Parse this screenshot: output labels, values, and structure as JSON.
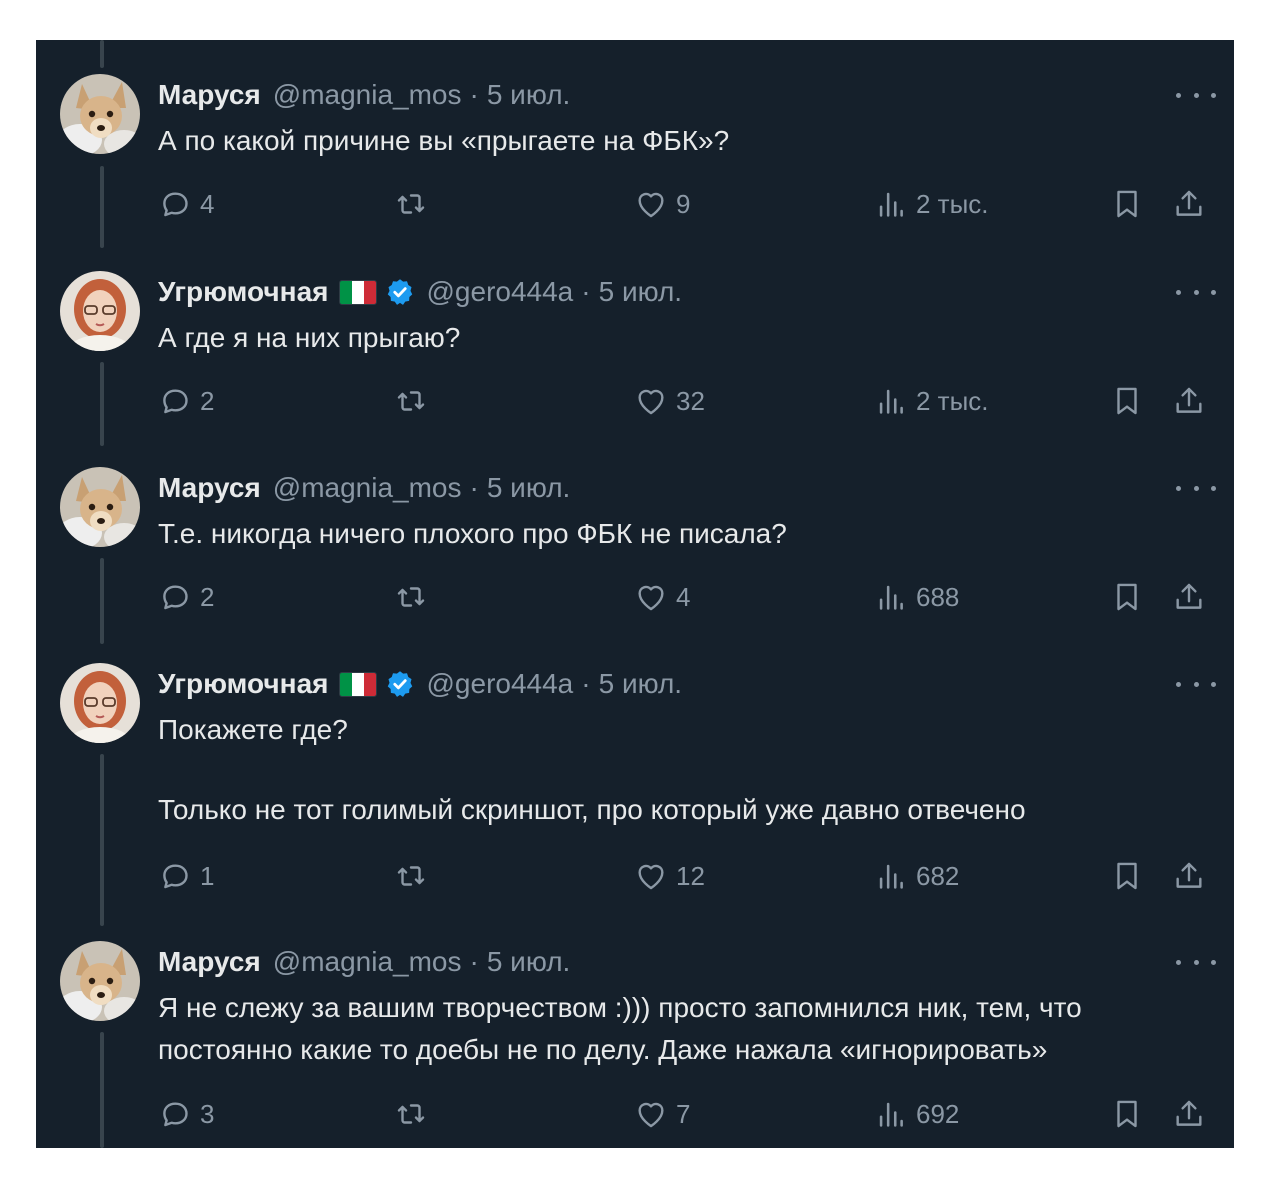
{
  "users": {
    "marusya": {
      "name": "Маруся",
      "handle": "@magnia_mos"
    },
    "ugryumochnaya": {
      "name": "Угрюмочная",
      "handle": "@gero444a",
      "flag_colors": [
        "#009246",
        "#ffffff",
        "#ce2b37"
      ],
      "verified_color": "#1d9bf0"
    }
  },
  "separator": "·",
  "tweets": [
    {
      "author": "marusya",
      "name": "Маруся",
      "handle": "@magnia_mos",
      "date": "5 июл.",
      "verified": false,
      "text": [
        "А по какой причине вы «прыгаете на ФБК»?"
      ],
      "stats": {
        "replies": "4",
        "likes": "9",
        "views": "2 тыс."
      }
    },
    {
      "author": "ugryumochnaya",
      "name": "Угрюмочная",
      "handle": "@gero444a",
      "date": "5 июл.",
      "verified": true,
      "text": [
        "А где я на них прыгаю?"
      ],
      "stats": {
        "replies": "2",
        "likes": "32",
        "views": "2 тыс."
      }
    },
    {
      "author": "marusya",
      "name": "Маруся",
      "handle": "@magnia_mos",
      "date": "5 июл.",
      "verified": false,
      "text": [
        "Т.е. никогда ничего плохого про ФБК не писала?"
      ],
      "stats": {
        "replies": "2",
        "likes": "4",
        "views": "688"
      }
    },
    {
      "author": "ugryumochnaya",
      "name": "Угрюмочная",
      "handle": "@gero444a",
      "date": "5 июл.",
      "verified": true,
      "text": [
        "Покажете где?",
        "",
        "Только не тот голимый скриншот, про который уже давно отвечено"
      ],
      "stats": {
        "replies": "1",
        "likes": "12",
        "views": "682"
      }
    },
    {
      "author": "marusya",
      "name": "Маруся",
      "handle": "@magnia_mos",
      "date": "5 июл.",
      "verified": false,
      "text": [
        "Я не слежу за вашим творчеством :))) просто запомнился ник, тем, что постоянно какие то доебы не по делу. Даже нажала «игнорировать»"
      ],
      "stats": {
        "replies": "3",
        "likes": "7",
        "views": "692"
      }
    }
  ],
  "icons": {
    "reply": "speech-bubble-icon",
    "retweet": "retweet-icon",
    "like": "heart-icon",
    "views": "bar-chart-icon",
    "bookmark": "bookmark-icon",
    "share": "share-icon",
    "more": "more-dots-icon"
  },
  "colors": {
    "background": "#15202b",
    "text": "#e7e9ea",
    "muted": "#8b98a5",
    "thread_line": "#38444d"
  }
}
